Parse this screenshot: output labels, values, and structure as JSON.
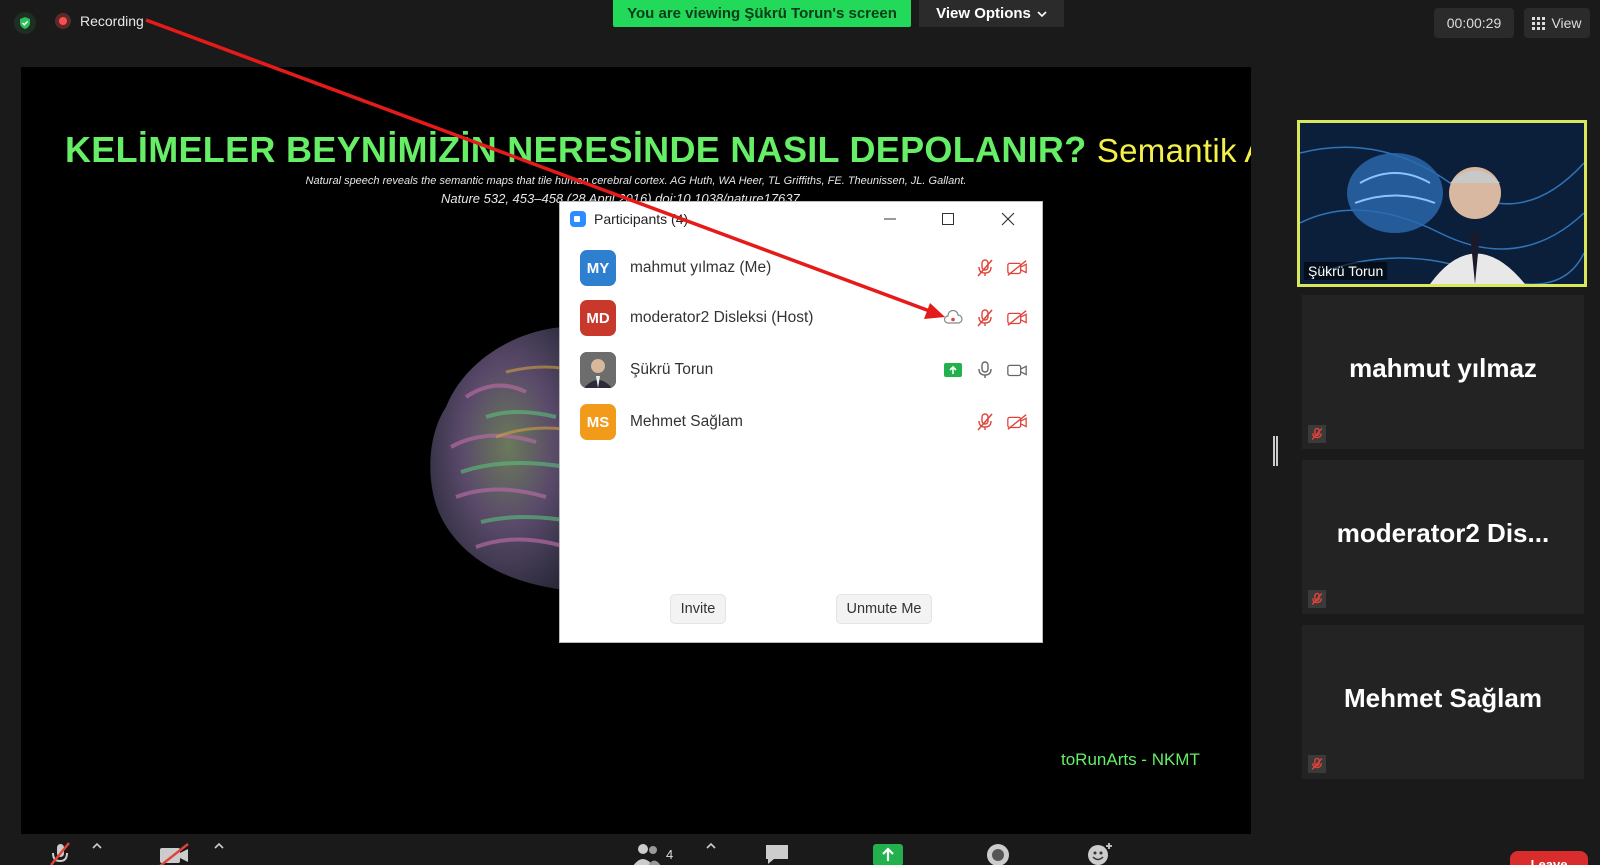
{
  "top_bar": {
    "recording_label": "Recording",
    "viewing_banner": "You are viewing Şükrü Torun's screen",
    "view_options_label": "View Options",
    "timer": "00:00:29",
    "view_label": "View"
  },
  "slide": {
    "title_main": "KELİMELER BEYNİMİZİN NERESİNDE NASIL DEPOLANIR?",
    "title_accent": "Semantik Atlas",
    "subtitle": "Natural speech reveals the semantic maps that tile human cerebral cortex. AG Huth, WA Heer, TL Griffiths, FE. Theunissen, JL. Gallant.",
    "citation": "Nature 532, 453–458 (28 April 2016) doi:10.1038/nature17637",
    "brand": "toRunArts - NKMT"
  },
  "participants": {
    "title": "Participants (4)",
    "list": [
      {
        "initials": "MY",
        "name": "mahmut yılmaz (Me)",
        "color": "#2f7fd1"
      },
      {
        "initials": "MD",
        "name": "moderator2 Disleksi (Host)",
        "color": "#c8382b"
      },
      {
        "initials": "",
        "name": "Şükrü Torun",
        "color": "#8a8a8a"
      },
      {
        "initials": "MS",
        "name": "Mehmet Sağlam",
        "color": "#f29a1a"
      }
    ],
    "invite_label": "Invite",
    "unmute_label": "Unmute Me"
  },
  "gallery": {
    "active_name": "Şükrü Torun",
    "tiles": [
      "mahmut yılmaz",
      "moderator2  Dis...",
      "Mehmet Sağlam"
    ]
  },
  "toolbar": {
    "participant_count": "4",
    "leave_label": "Leave"
  },
  "colors": {
    "share_green": "#23d959",
    "slide_green": "#66ee66",
    "slide_yellow": "#f4f04a",
    "mute_red": "#e0433a",
    "active_border": "#d8e85a"
  }
}
